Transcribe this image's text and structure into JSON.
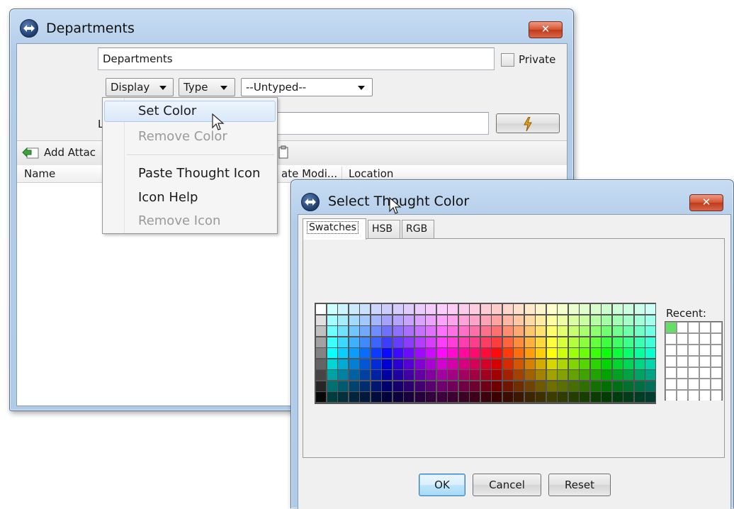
{
  "departments_window": {
    "title": "Departments",
    "close_label": "✕",
    "name_value": "Departments",
    "private_label": "Private",
    "display_label": "Display",
    "type_label": "Type",
    "untyped_value": "--Untyped--",
    "label_prefix": "L",
    "add_attachment_label": "Add Attac",
    "columns": [
      "Name",
      "ate Modi...",
      "Location"
    ]
  },
  "display_menu": {
    "items": [
      {
        "label": "Set Color",
        "enabled": true
      },
      {
        "label": "Remove Color",
        "enabled": false
      },
      {
        "label": "Paste Thought Icon",
        "enabled": true
      },
      {
        "label": "Icon Help",
        "enabled": true
      },
      {
        "label": "Remove Icon",
        "enabled": false
      }
    ]
  },
  "color_window": {
    "title": "Select Thought Color",
    "close_label": "✕",
    "tabs": [
      {
        "label": "Swatches",
        "active": true
      },
      {
        "label": "HSB",
        "active": false
      },
      {
        "label": "RGB",
        "active": false
      }
    ],
    "recent_label": "Recent:",
    "recent_colors": [
      "#66dd66"
    ],
    "buttons": {
      "ok": "OK",
      "cancel": "Cancel",
      "reset": "Reset"
    }
  }
}
